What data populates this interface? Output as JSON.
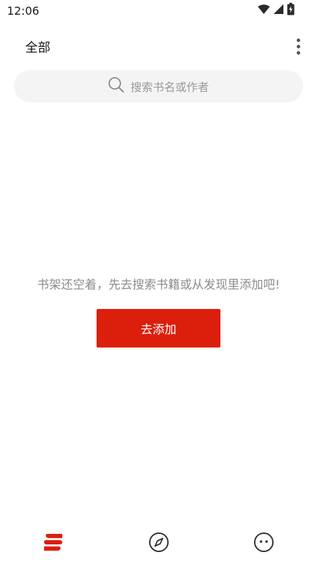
{
  "status_bar": {
    "time": "12:06",
    "icons": [
      "wifi-icon",
      "signal-icon",
      "battery-charging-icon"
    ]
  },
  "header": {
    "title": "全部",
    "menu_icon": "more-vertical-icon"
  },
  "search": {
    "placeholder": "搜索书名或作者",
    "icon": "search-icon"
  },
  "empty_state": {
    "message": "书架还空着，先去搜索书籍或从发现里添加吧!",
    "button_label": "去添加"
  },
  "bottom_nav": {
    "items": [
      {
        "icon": "bookshelf-icon",
        "active": true
      },
      {
        "icon": "compass-icon",
        "active": false
      },
      {
        "icon": "smiley-face-icon",
        "active": false
      }
    ]
  },
  "colors": {
    "accent": "#dc1f0d",
    "search_bg": "#f4f4f4",
    "placeholder": "#9a9a9a",
    "empty_text": "#8c8c8c",
    "nav_inactive": "#333333"
  }
}
